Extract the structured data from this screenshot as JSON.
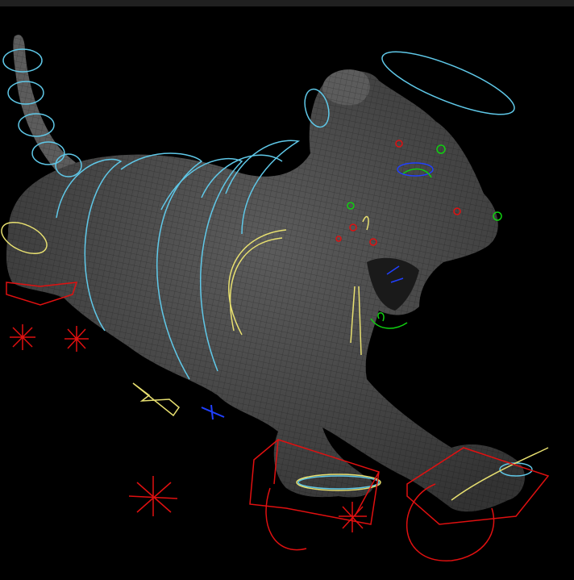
{
  "viewport": {
    "background": "#000000",
    "toolbar_color": "#202020",
    "mesh_color": "#5a5a5a",
    "wire_color": "#3a3a3a"
  },
  "rig_colors": {
    "spine": "#5fc8e8",
    "secondary": "#e8e070",
    "ik": "#e01010",
    "face_left": "#10d010",
    "face_right": "#e01010",
    "face_center": "#2040ff"
  }
}
